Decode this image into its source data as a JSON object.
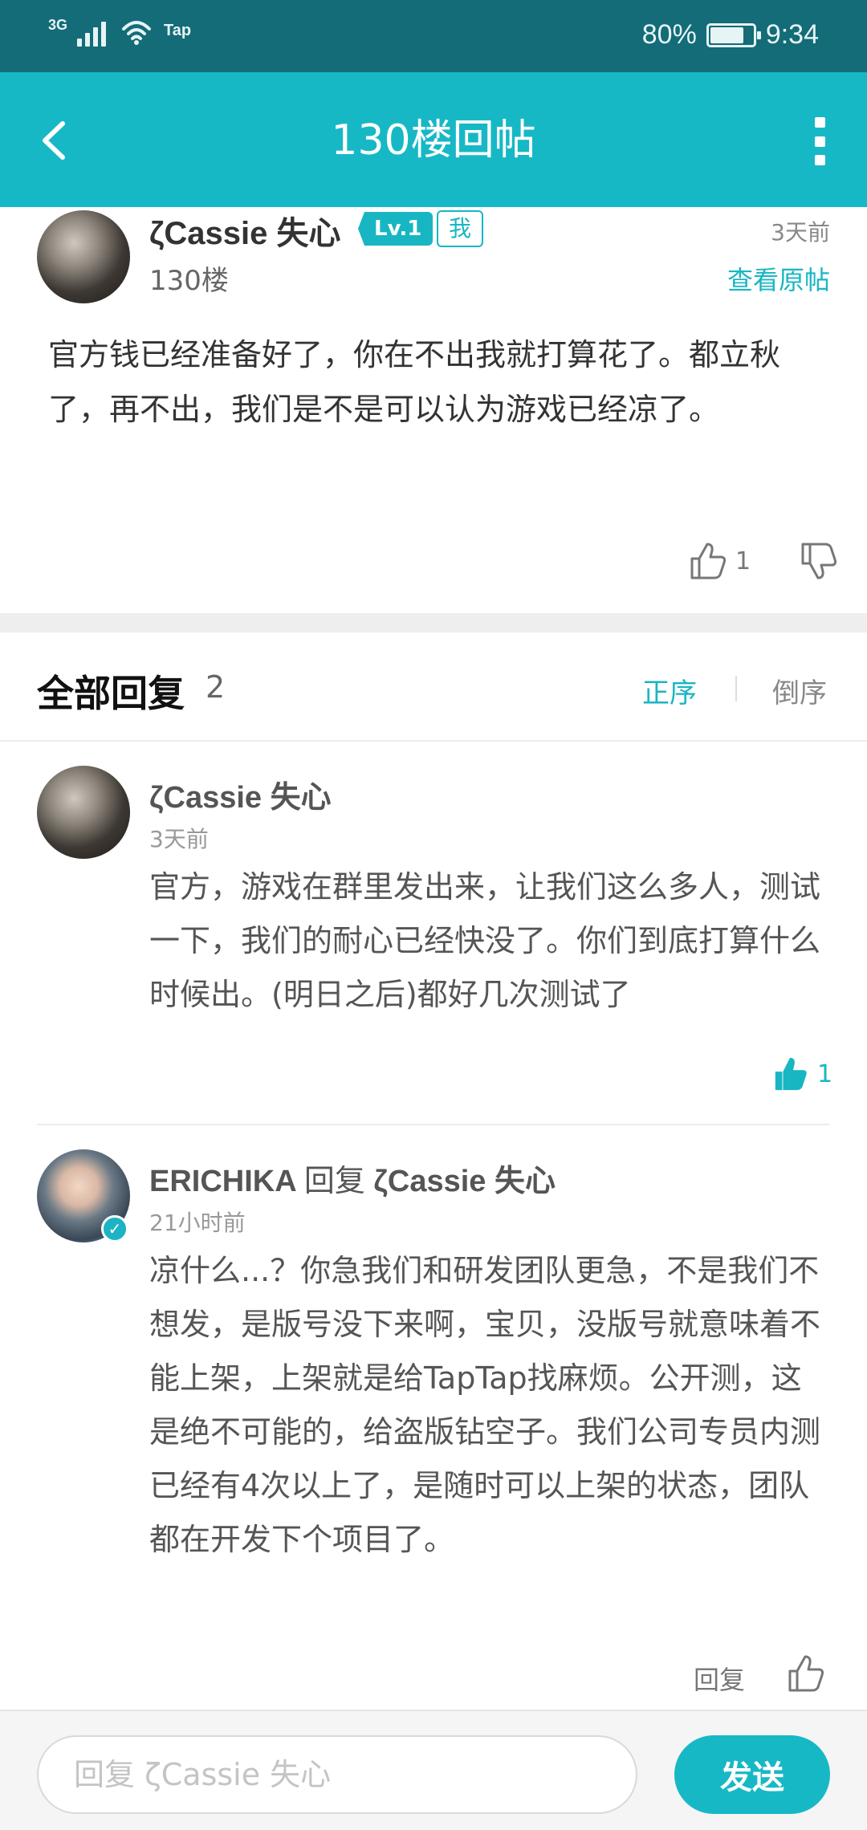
{
  "status_bar": {
    "network": "3G",
    "app_indicator": "Tap",
    "battery_percent": "80%",
    "battery_level": 0.8,
    "time": "9:34"
  },
  "header": {
    "title": "130楼回帖",
    "back_icon": "chevron-left-icon",
    "more_icon": "more-vertical-icon"
  },
  "post": {
    "author": "ζCassie 失心",
    "level_badge": "Lv.1",
    "self_badge": "我",
    "time": "3天前",
    "floor": "130楼",
    "view_original": "查看原帖",
    "body": "官方钱已经准备好了，你在不出我就打算花了。都立秋了，再不出，我们是不是可以认为游戏已经凉了。",
    "likes": "1"
  },
  "replies_header": {
    "title": "全部回复",
    "count": "2",
    "sort_asc": "正序",
    "sort_desc": "倒序"
  },
  "replies": [
    {
      "author": "ζCassie 失心",
      "time": "3天前",
      "body": "官方，游戏在群里发出来，让我们这么多人，测试一下，我们的耐心已经快没了。你们到底打算什么时候出。(明日之后)都好几次测试了",
      "likes": "1"
    },
    {
      "author": "ERICHIKA",
      "reply_word": "回复",
      "reply_to": "ζCassie 失心",
      "time": "21小时前",
      "body": "凉什么...？你急我们和研发团队更急，不是我们不想发，是版号没下来啊，宝贝，没版号就意味着不能上架，上架就是给TapTap找麻烦。公开测，这是绝不可能的，给盗版钻空子。我们公司专员内测已经有4次以上了，是随时可以上架的状态，团队都在开发下个项目了。",
      "reply_action": "回复"
    }
  ],
  "bottom": {
    "input_placeholder": "回复 ζCassie 失心",
    "input_value": "",
    "send_label": "发送"
  },
  "colors": {
    "status_bar": "#136c77",
    "accent": "#17b8c6",
    "text": "#333333"
  }
}
